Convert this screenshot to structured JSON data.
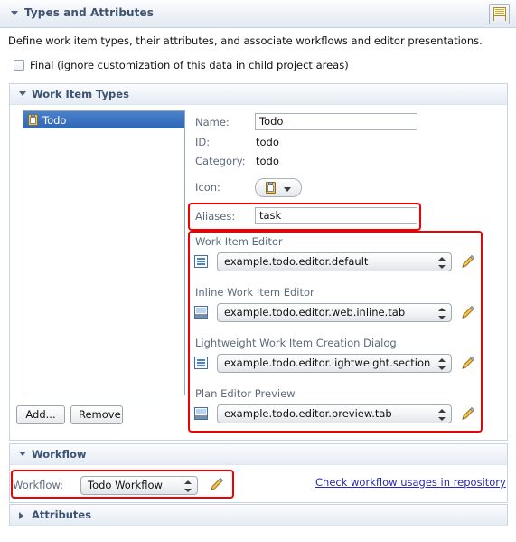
{
  "header": {
    "title": "Types and Attributes",
    "twisty": "twisty-down-icon",
    "tool_icon": "form-page-icon"
  },
  "intro": "Define work item types, their attributes, and associate workflows and editor presentations.",
  "final_checkbox": {
    "label": "Final (ignore customization of this data in child project areas)",
    "checked": false
  },
  "sections": {
    "work_item_types": {
      "title": "Work Item Types",
      "expanded": true
    },
    "workflow": {
      "title": "Workflow",
      "expanded": true
    },
    "attributes": {
      "title": "Attributes",
      "expanded": false
    }
  },
  "type_list": {
    "items": [
      {
        "label": "Todo",
        "icon": "clipboard-icon",
        "selected": true
      }
    ]
  },
  "list_buttons": {
    "add": "Add...",
    "remove": "Remove"
  },
  "details": {
    "name_label": "Name:",
    "name_value": "Todo",
    "id_label": "ID:",
    "id_value": "todo",
    "category_label": "Category:",
    "category_value": "todo",
    "icon_label": "Icon:",
    "icon_button_icon": "clipboard-icon",
    "aliases_label": "Aliases:",
    "aliases_value": "task"
  },
  "presentations": [
    {
      "label": "Work Item Editor",
      "icon": "form-presentation-icon",
      "value": "example.todo.editor.default",
      "edit_icon": "pencil-icon"
    },
    {
      "label": "Inline Work Item Editor",
      "icon": "tab-presentation-icon",
      "value": "example.todo.editor.web.inline.tab",
      "edit_icon": "pencil-icon"
    },
    {
      "label": "Lightweight Work Item Creation Dialog",
      "icon": "form-presentation-icon",
      "value": "example.todo.editor.lightweight.section",
      "edit_icon": "pencil-icon"
    },
    {
      "label": "Plan Editor Preview",
      "icon": "tab-presentation-icon",
      "value": "example.todo.editor.preview.tab",
      "edit_icon": "pencil-icon"
    }
  ],
  "workflow": {
    "label": "Workflow:",
    "value": "Todo Workflow",
    "edit_icon": "pencil-icon",
    "link": "Check workflow usages in repository"
  },
  "colors": {
    "annotation": "#f00000",
    "selection": "#2f66b5",
    "section_title": "#3c5372",
    "link": "#2a2ab0"
  }
}
